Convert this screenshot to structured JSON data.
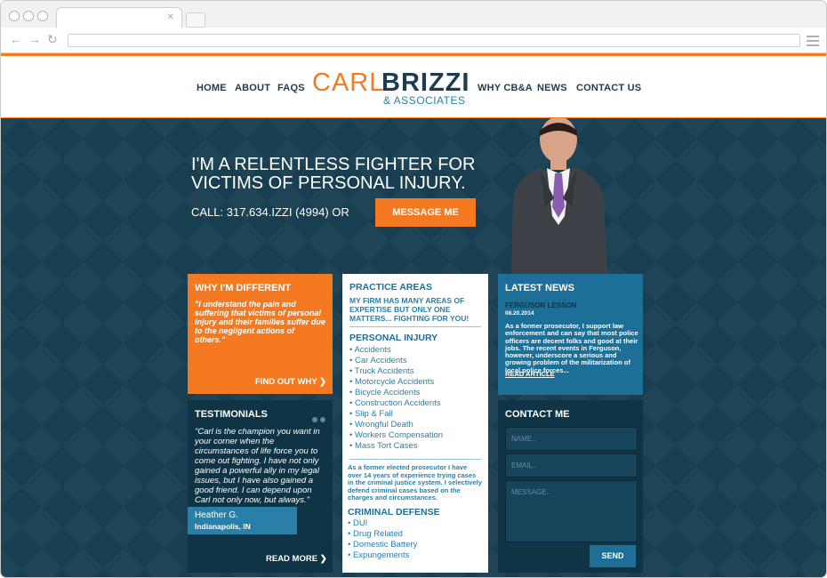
{
  "nav": {
    "items": [
      "HOME",
      "ABOUT",
      "FAQS",
      "WHY CB&A",
      "NEWS",
      "CONTACT US"
    ]
  },
  "logo": {
    "first": "CARL",
    "last": "BRIZZI",
    "sub": "& ASSOCIATES"
  },
  "hero": {
    "headline_1": "I'M A RELENTLESS FIGHTER FOR",
    "headline_2": "VICTIMS OF PERSONAL INJURY.",
    "call": "CALL: 317.634.IZZI (4994) OR",
    "button": "MESSAGE ME"
  },
  "different": {
    "title": "WHY I'M DIFFERENT",
    "quote": "\"I understand the pain and suffering that victims of personal injury and their families suffer due to the negligent actions of others.\"",
    "link": "FIND OUT WHY ❯"
  },
  "testimonials": {
    "title": "TESTIMONIALS",
    "quote": "\"Carl is the champion you want in your corner when the circumstances of life force you to come out fighting. I have not only gained a powerful ally in my legal issues, but I have also gained a good friend. I can depend upon Carl not only now, but always.\"",
    "name": "Heather G.",
    "location": "Indianapolis, IN",
    "link": "READ MORE ❯"
  },
  "practice": {
    "title": "PRACTICE AREAS",
    "subtitle": "MY FIRM HAS MANY AREAS OF EXPERTISE BUT ONLY ONE MATTERS... FIGHTING FOR YOU!",
    "personal_title": "PERSONAL INJURY",
    "personal_items": [
      "• Accidents",
      "• Car Accidents",
      "• Truck Accidents",
      "• Motorcycle Accidents",
      "• Bicycle Accidents",
      "• Construction Accidents",
      "• Slip & Fall",
      "• Wrongful Death",
      "• Workers Compensation",
      "• Mass Tort Cases"
    ],
    "note": "As a former elected prosecutor I have over 14 years of experience trying cases in the criminal justice system. I selectively defend criminal cases based on the charges and circumstances.",
    "criminal_title": "CRIMINAL DEFENSE",
    "criminal_items": [
      "• DUI",
      "• Drug Related",
      "• Domestic Battery",
      "• Expungements"
    ]
  },
  "news": {
    "title": "LATEST NEWS",
    "headline": "FERGUSON LESSON",
    "date": "08.20.2014",
    "body": "As a former prosecutor, I support law enforcement and can say that most police officers are decent folks and good at their jobs. The recent events in Ferguson, however, underscore a serious and growing problem of the militarization of local police forces...",
    "link": "READ ARTICLE"
  },
  "contact": {
    "title": "CONTACT ME",
    "name_placeholder": "NAME..",
    "email_placeholder": "EMAIL..",
    "message_placeholder": "MESSAGE..",
    "send": "SEND"
  }
}
